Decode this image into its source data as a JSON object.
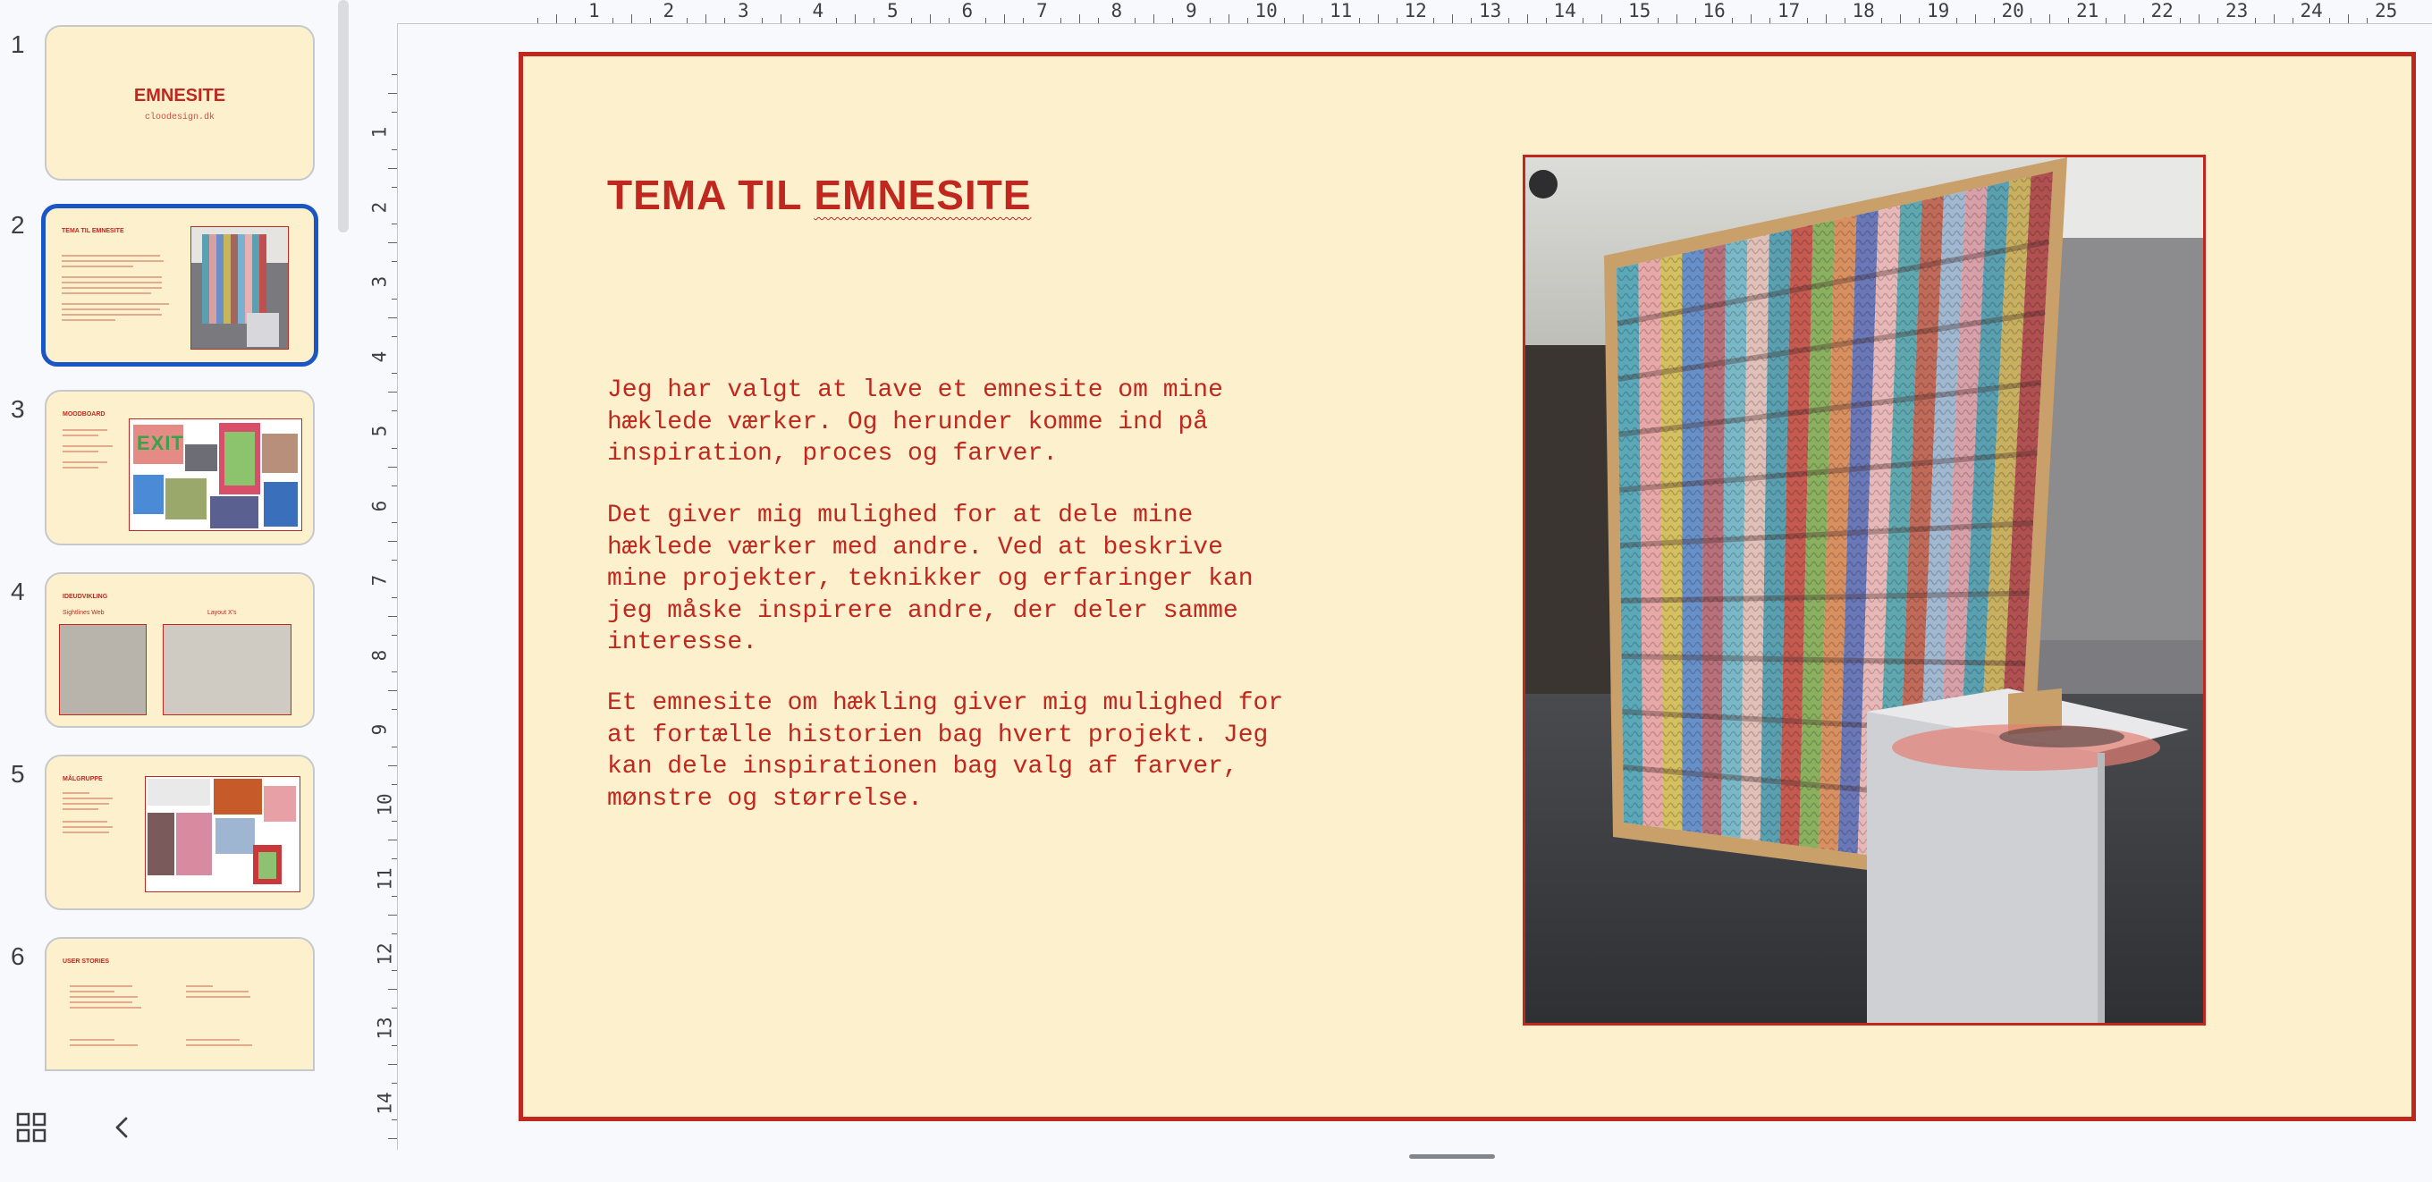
{
  "filmstrip": {
    "slides": [
      {
        "number": "1",
        "title": "EMNESITE",
        "subtitle": "cloodesign.dk"
      },
      {
        "number": "2",
        "title": "TEMA TIL EMNESITE"
      },
      {
        "number": "3",
        "title": "MOODBOARD",
        "image_text": "EXIT"
      },
      {
        "number": "4",
        "title": "IDEUDVIKLING",
        "label_a": "Sightlines Web",
        "label_b": "Layout X's"
      },
      {
        "number": "5",
        "title": "MÅLGRUPPE"
      },
      {
        "number": "6",
        "title": "USER STORIES"
      }
    ]
  },
  "ruler": {
    "horizontal": [
      "1",
      "2",
      "3",
      "4",
      "5",
      "6",
      "7",
      "8",
      "9",
      "10",
      "11",
      "12",
      "13",
      "14",
      "15",
      "16",
      "17",
      "18",
      "19",
      "20",
      "21",
      "22",
      "23",
      "24",
      "25"
    ],
    "vertical": [
      "1",
      "2",
      "3",
      "4",
      "5",
      "6",
      "7",
      "8",
      "9",
      "10",
      "11",
      "12",
      "13",
      "14"
    ]
  },
  "slide": {
    "title_part1": "TEMA TIL ",
    "title_part2": "EMNESITE",
    "paragraph1": "Jeg har valgt at lave et emnesite om mine\nhæklede værker.  Og herunder komme ind på\ninspiration, proces og farver.",
    "paragraph2": "Det giver mig mulighed for at dele mine\nhæklede værker med andre. Ved at beskrive\nmine projekter, teknikker og erfaringer kan\njeg måske inspirere andre, der deler samme\ninteresse.",
    "paragraph3": "Et emnesite om hækling giver mig mulighed for\nat fortælle historien bag hvert projekt. Jeg\nkan dele inspirationen bag valg af farver,\nmønstre og størrelse."
  },
  "colors": {
    "accent": "#c0271f",
    "slide_background": "#fdf0cc",
    "selection": "#1a56c4"
  },
  "icons": {
    "grid_view": "grid-icon",
    "collapse": "chevron-left-icon"
  }
}
